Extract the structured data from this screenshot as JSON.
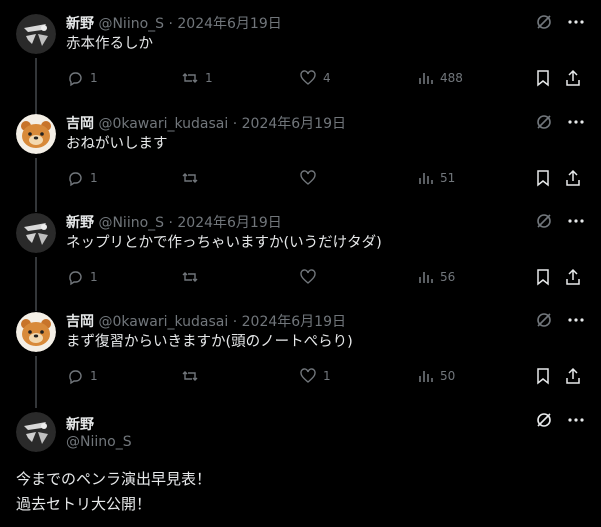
{
  "tweets": [
    {
      "name": "新野",
      "handle": "@Niino_S",
      "sep": "·",
      "date": "2024年6月19日",
      "text": "赤本作るしか",
      "replies": "1",
      "retweets": "1",
      "likes": "4",
      "views": "488",
      "avatar": "ink"
    },
    {
      "name": "吉岡",
      "handle": "@0kawari_kudasai",
      "sep": "·",
      "date": "2024年6月19日",
      "text": "おねがいします",
      "replies": "1",
      "retweets": "",
      "likes": "",
      "views": "51",
      "avatar": "bear"
    },
    {
      "name": "新野",
      "handle": "@Niino_S",
      "sep": "·",
      "date": "2024年6月19日",
      "text": "ネップリとかで作っちゃいますか(いうだけタダ)",
      "replies": "1",
      "retweets": "",
      "likes": "",
      "views": "56",
      "avatar": "ink"
    },
    {
      "name": "吉岡",
      "handle": "@0kawari_kudasai",
      "sep": "·",
      "date": "2024年6月19日",
      "text": "まず復習からいきますか(頭のノートぺらり)",
      "replies": "1",
      "retweets": "",
      "likes": "1",
      "views": "50",
      "avatar": "bear"
    }
  ],
  "main_tweet": {
    "name": "新野",
    "handle": "@Niino_S",
    "line1": "今までのペンラ演出早見表！",
    "line2": "過去セトリ大公開！"
  },
  "colors": {
    "background": "#000000",
    "text": "#e7e9ea",
    "muted": "#71767b",
    "line": "#333639"
  }
}
